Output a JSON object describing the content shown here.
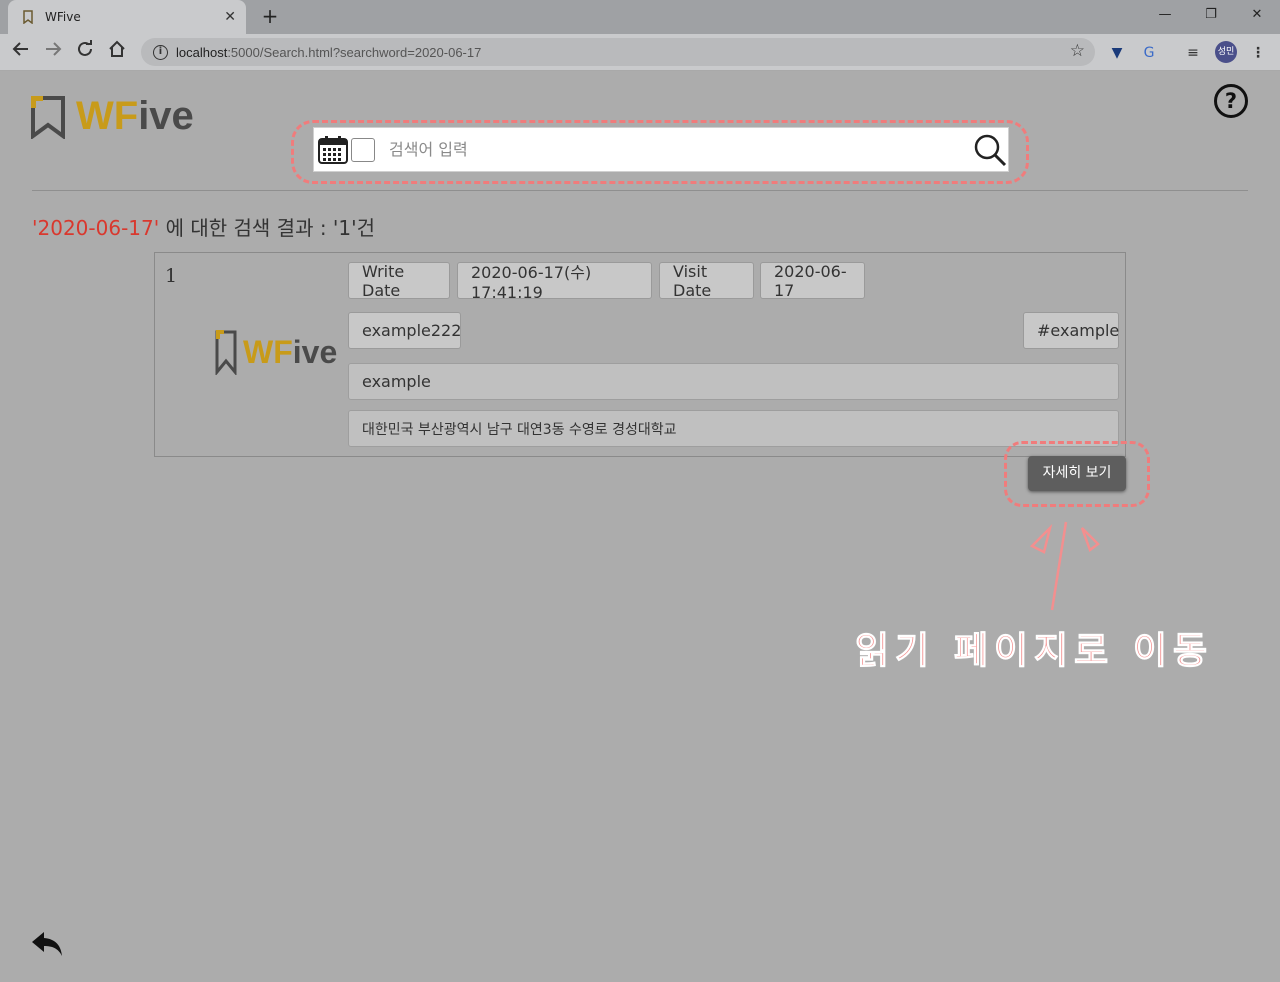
{
  "browser": {
    "tab_title": "WFive",
    "tab_close": "✕",
    "new_tab": "+",
    "window": {
      "minimize": "—",
      "restore": "❐",
      "close": "✕"
    },
    "url_host": "localhost",
    "url_rest": ":5000/Search.html?searchword=2020-06-17",
    "profile_label": "성민"
  },
  "header": {
    "logo_primary": "WF",
    "logo_secondary": "ive",
    "help_symbol": "?"
  },
  "search": {
    "placeholder": "검색어 입력",
    "value": ""
  },
  "results": {
    "keyword": "'2020-06-17'",
    "summary_text": " 에 대한 검색 결과 : '1'건"
  },
  "card": {
    "index": "1",
    "logo_primary": "WF",
    "logo_secondary": "ive",
    "write_date_label": "Write Date",
    "write_date_value": "2020-06-17(수) 17:41:19",
    "visit_date_label": "Visit Date",
    "visit_date_value": "2020-06-17",
    "title": "example222",
    "tag": "#example",
    "content": "example",
    "address": "대한민국 부산광역시 남구 대연3동 수영로 경성대학교",
    "detail_button": "자세히 보기"
  },
  "annotation": {
    "text": "읽기 페이지로 이동",
    "color": "#f38f8f"
  },
  "colors": {
    "background": "#acacac",
    "accent": "#c89b1a",
    "keyword": "#d9382e",
    "highlight_outline": "#f07c7c"
  }
}
